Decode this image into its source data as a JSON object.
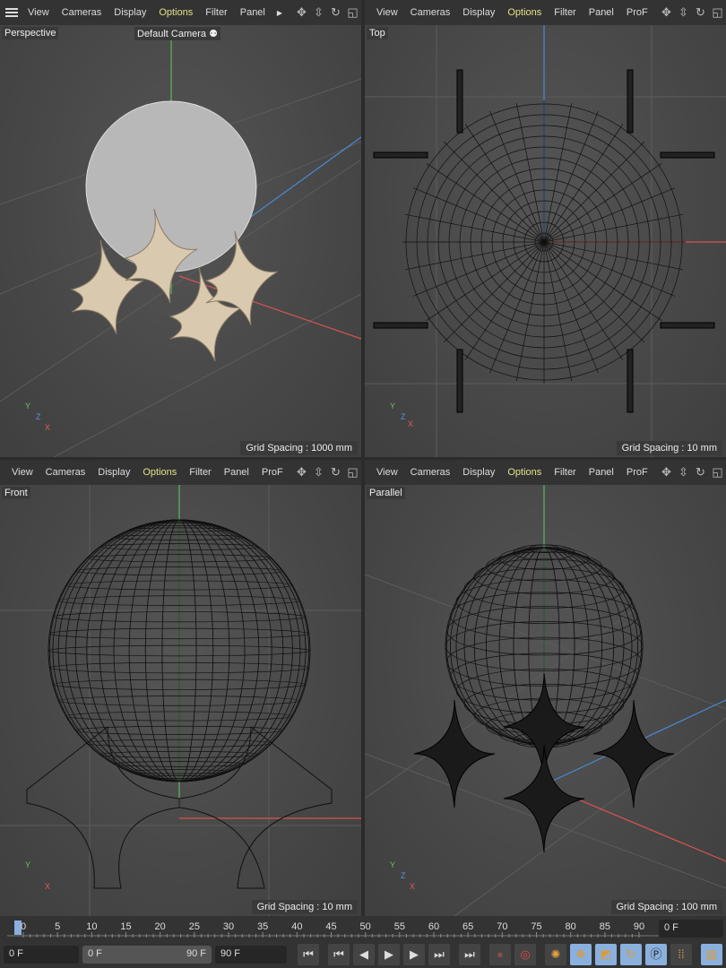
{
  "viewports": [
    {
      "name": "Perspective",
      "camera": "Default Camera",
      "grid": "Grid Spacing : 1000 mm",
      "menus": [
        "View",
        "Cameras",
        "Display",
        "Options",
        "Filter",
        "Panel"
      ],
      "hamburger": true
    },
    {
      "name": "Top",
      "grid": "Grid Spacing : 10 mm",
      "menus": [
        "View",
        "Cameras",
        "Display",
        "Options",
        "Filter",
        "Panel",
        "ProF"
      ]
    },
    {
      "name": "Front",
      "grid": "Grid Spacing : 10 mm",
      "menus": [
        "View",
        "Cameras",
        "Display",
        "Options",
        "Filter",
        "Panel",
        "ProF"
      ]
    },
    {
      "name": "Parallel",
      "grid": "Grid Spacing : 100 mm",
      "menus": [
        "View",
        "Cameras",
        "Display",
        "Options",
        "Filter",
        "Panel",
        "ProF"
      ]
    }
  ],
  "active_menu": "Options",
  "axes": {
    "x": "X",
    "y": "Y",
    "z": "Z"
  },
  "timeline": {
    "ticks": [
      "0",
      "5",
      "10",
      "15",
      "20",
      "25",
      "30",
      "35",
      "40",
      "45",
      "50",
      "55",
      "60",
      "65",
      "70",
      "75",
      "80",
      "85",
      "90"
    ],
    "current_frame": "0 F"
  },
  "controls": {
    "current": "0 F",
    "range_start": "0 F",
    "range_end": "90 F",
    "end": "90 F"
  },
  "colors": {
    "accent": "#e6e08a",
    "x_axis": "#d9534f",
    "y_axis": "#5cb85c",
    "z_axis": "#4a8ad4",
    "timeline_active": "#8ab0de"
  }
}
